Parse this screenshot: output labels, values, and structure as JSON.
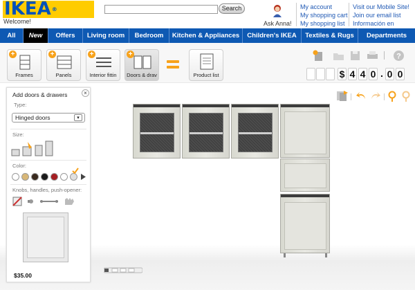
{
  "header": {
    "logo_text": "IKEA",
    "logo_mark": "®",
    "welcome": "Welcome!",
    "search_placeholder": "",
    "search_button": "Search",
    "ask_anna": "Ask Anna!",
    "links_col1": [
      "My account",
      "My shopping cart",
      "My shopping list"
    ],
    "links_col2": [
      "Visit our Mobile Site!",
      "Join our email list",
      "Información en español"
    ]
  },
  "nav": {
    "items": [
      "All",
      "New",
      "Offers",
      "Living room",
      "Bedroom",
      "Kitchen & Appliances",
      "Children's IKEA",
      "Textiles & Rugs",
      "Departments"
    ]
  },
  "toolbar": {
    "buttons": [
      "Frames",
      "Panels",
      "Interior fittin",
      "Doors & drav"
    ],
    "product_list": "Product list",
    "price_digits": [
      "",
      "",
      "",
      "$",
      "4",
      "4",
      "0",
      ".",
      "0",
      "0"
    ]
  },
  "panel": {
    "title": "Add doors & drawers",
    "type_label": "Type:",
    "type_value": "Hinged doors",
    "size_label": "Size:",
    "color_label": "Color:",
    "knobs_label": "Knobs, handles, push-opener:",
    "price": "$35.00",
    "colors": [
      "#ffffff",
      "#d8b777",
      "#3a2a1e",
      "#1a1a1a",
      "#a51e22",
      "#ffffff",
      "#e0e0e0"
    ]
  },
  "colors": {
    "ikea_blue": "#0051ba",
    "ikea_yellow": "#ffcc00",
    "nav_blue": "#0e59b3",
    "accent_orange": "#f7a21b",
    "link_blue": "#1e58b4"
  }
}
